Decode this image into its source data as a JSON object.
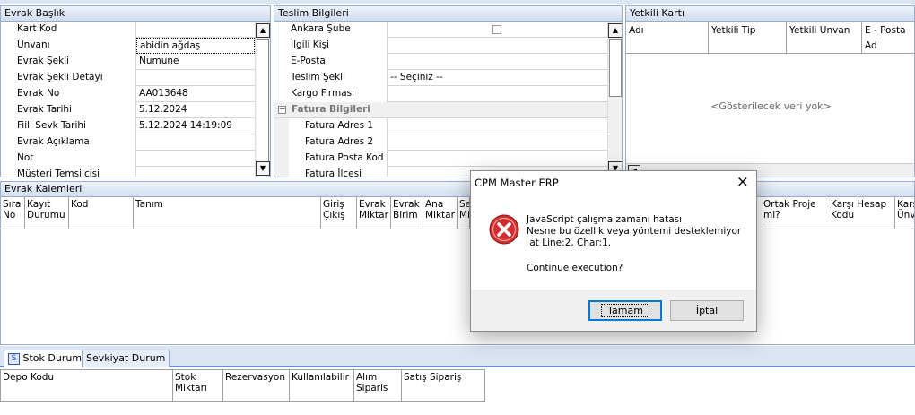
{
  "evrak_baslik": {
    "title": "Evrak Başlık",
    "rows": [
      {
        "label": "Kart Kod",
        "value": ""
      },
      {
        "label": "Ünvanı",
        "value": "abidin ağdaş"
      },
      {
        "label": "Evrak Şekli",
        "value": "Numune"
      },
      {
        "label": "Evrak Şekli Detayı",
        "value": ""
      },
      {
        "label": "Evrak No",
        "value": "AA013648"
      },
      {
        "label": "Evrak Tarihi",
        "value": "5.12.2024"
      },
      {
        "label": "Fiili Sevk Tarihi",
        "value": "5.12.2024 14:19:09"
      },
      {
        "label": "Evrak Açıklama",
        "value": ""
      },
      {
        "label": "Not",
        "value": ""
      },
      {
        "label": "Müşteri Temsilcisi",
        "value": ""
      }
    ]
  },
  "teslim_bilgileri": {
    "title": "Teslim Bilgileri",
    "rows": [
      {
        "label": "Ankara Şube",
        "value": ""
      },
      {
        "label": "İlgili Kişi",
        "value": ""
      },
      {
        "label": "E-Posta",
        "value": ""
      },
      {
        "label": "Teslim Şekli",
        "value": "-- Seçiniz --"
      },
      {
        "label": "Kargo Firması",
        "value": ""
      }
    ],
    "fatura_group": "Fatura Bilgileri",
    "fatura_rows": [
      {
        "label": "Fatura Adres 1",
        "value": ""
      },
      {
        "label": "Fatura Adres 2",
        "value": ""
      },
      {
        "label": "Fatura Posta Kod",
        "value": ""
      },
      {
        "label": "Fatura İlçesi",
        "value": ""
      }
    ]
  },
  "yetkili_karti": {
    "title": "Yetkili Kartı",
    "columns": [
      "Adı",
      "Yetkili Tip",
      "Yetkili Unvan",
      "E - Posta Ad"
    ],
    "empty_text": "<Gösterilecek veri yok>"
  },
  "evrak_kalemleri": {
    "title": "Evrak Kalemleri",
    "columns": [
      "Sıra No",
      "Kayıt Durumu",
      "Kod",
      "Tanım",
      "Giriş Çıkış",
      "Evrak Miktar",
      "Evrak Birim",
      "Ana Miktar",
      "Se Mi",
      "Ortak Proje mi?",
      "Karşı Hesap Kodu",
      "Karşı Ünva"
    ]
  },
  "bottom_tabs": {
    "tabs": [
      "Stok Durum",
      "Sevkiyat Durum"
    ],
    "tab_icon": "S",
    "columns": [
      "Depo Kodu",
      "Stok Miktarı",
      "Rezervasyon",
      "Kullanılabilir",
      "Alım Siparis",
      "Satış Sipariş"
    ]
  },
  "dialog": {
    "title": "CPM Master ERP",
    "close_icon": "×",
    "message_line1": "JavaScript çalışma zamanı hatası",
    "message_line2": "Nesne bu özellik veya yöntemi desteklemiyor",
    "message_line3": " at Line:2, Char:1.",
    "question": "Continue execution?",
    "ok_label": "Tamam",
    "cancel_label": "İptal"
  },
  "colors": {
    "panel_header": "#d2ddf0",
    "border": "#9aaccc",
    "error_icon": "#d32f2f",
    "default_button": "#0078d7"
  }
}
